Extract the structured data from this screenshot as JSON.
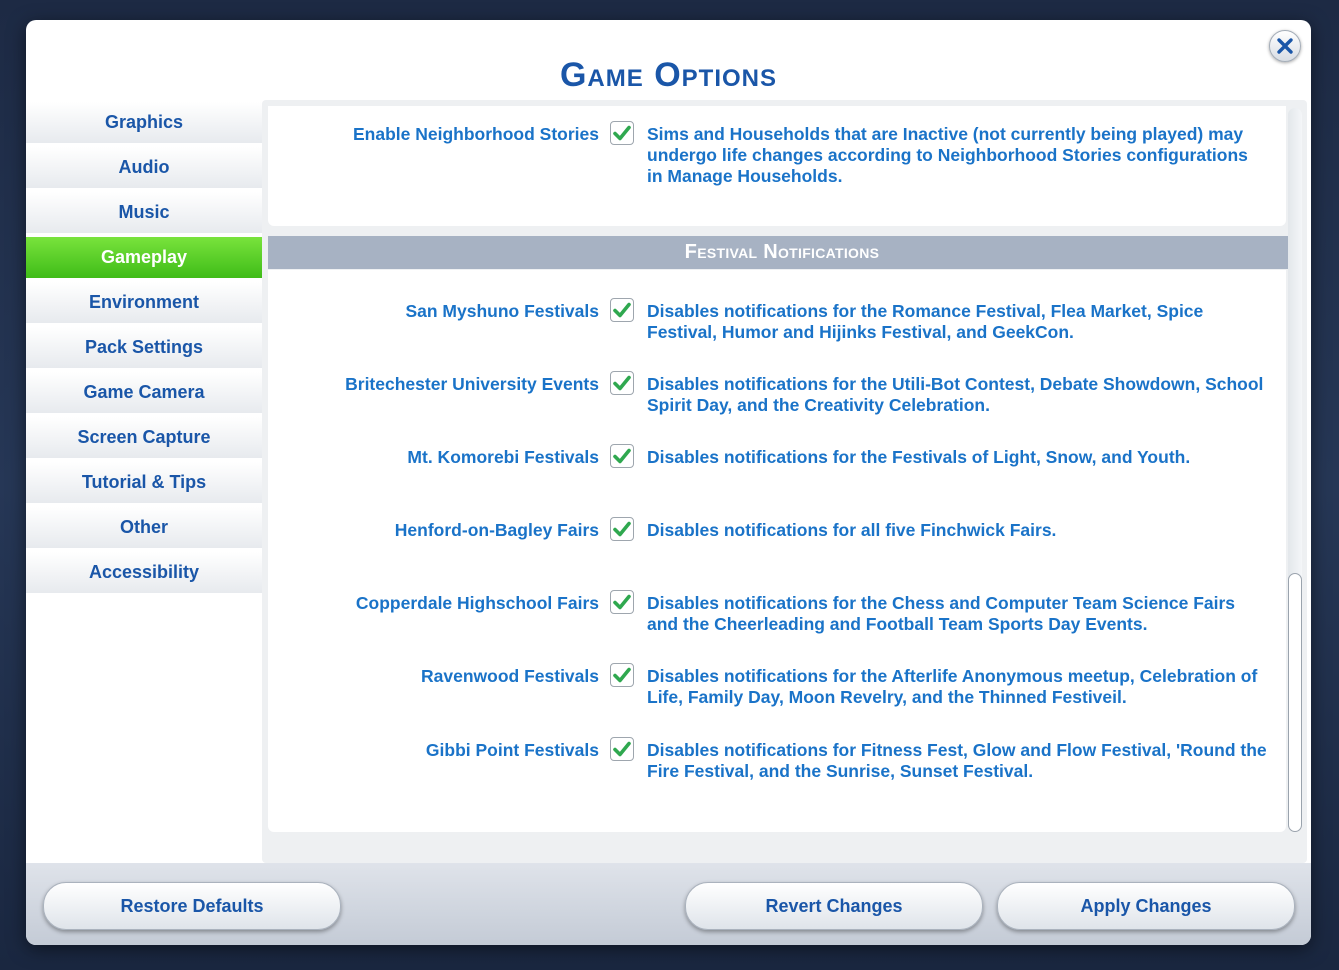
{
  "dialog": {
    "title": "Game Options"
  },
  "sidebar": {
    "items": [
      {
        "label": "Graphics"
      },
      {
        "label": "Audio"
      },
      {
        "label": "Music"
      },
      {
        "label": "Gameplay",
        "active": true
      },
      {
        "label": "Environment"
      },
      {
        "label": "Pack Settings"
      },
      {
        "label": "Game Camera"
      },
      {
        "label": "Screen Capture"
      },
      {
        "label": "Tutorial & Tips"
      },
      {
        "label": "Other"
      },
      {
        "label": "Accessibility"
      }
    ]
  },
  "top_option": {
    "label": "Enable Neighborhood Stories",
    "checked": true,
    "description": "Sims and Households that are Inactive (not currently being played) may undergo life changes according to Neighborhood Stories configurations in Manage Households."
  },
  "section": {
    "title": "Festival Notifications"
  },
  "options": [
    {
      "label": "San Myshuno Festivals",
      "checked": true,
      "description": "Disables notifications for the Romance Festival, Flea Market, Spice Festival, Humor and Hijinks Festival, and GeekCon."
    },
    {
      "label": "Britechester University Events",
      "checked": true,
      "description": "Disables notifications for the Utili-Bot Contest, Debate Showdown, School Spirit Day, and the Creativity Celebration."
    },
    {
      "label": "Mt. Komorebi Festivals",
      "checked": true,
      "description": "Disables notifications for the Festivals of Light, Snow, and Youth."
    },
    {
      "label": "Henford-on-Bagley Fairs",
      "checked": true,
      "description": "Disables notifications for all five Finchwick Fairs."
    },
    {
      "label": "Copperdale Highschool Fairs",
      "checked": true,
      "description": "Disables notifications for the Chess and Computer Team Science Fairs and the Cheerleading and Football Team Sports Day Events."
    },
    {
      "label": "Ravenwood Festivals",
      "checked": true,
      "description": "Disables notifications for the Afterlife Anonymous meetup, Celebration of Life, Family Day, Moon Revelry, and the Thinned Festiveil."
    },
    {
      "label": "Gibbi Point Festivals",
      "checked": true,
      "description": "Disables notifications for Fitness Fest, Glow and Flow Festival, 'Round the Fire Festival, and the Sunrise, Sunset Festival."
    }
  ],
  "footer": {
    "restore_label": "Restore Defaults",
    "revert_label": "Revert Changes",
    "apply_label": "Apply Changes"
  },
  "colors": {
    "accent": "#1a56a8",
    "text_blue": "#1a73c8",
    "active_green": "#4cc61f",
    "section_header": "#a7b2c3",
    "check_green": "#2fa84f"
  },
  "icons": {
    "close": "close-icon",
    "check": "checkmark-icon"
  }
}
